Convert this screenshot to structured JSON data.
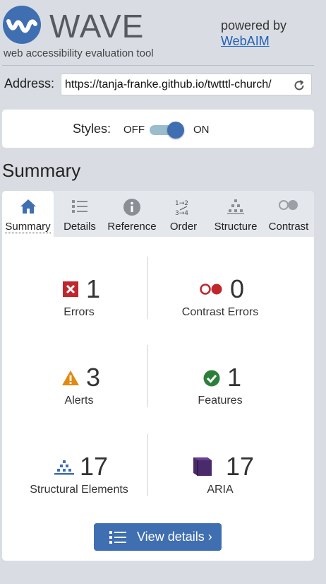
{
  "header": {
    "title": "WAVE",
    "tagline": "web accessibility evaluation tool",
    "powered_by": "powered by",
    "webaim_link": "WebAIM"
  },
  "address": {
    "label": "Address:",
    "value": "https://tanja-franke.github.io/twtttl-church/"
  },
  "styles": {
    "label": "Styles:",
    "off": "OFF",
    "on": "ON",
    "state": "on"
  },
  "summary_heading": "Summary",
  "tabs": [
    {
      "label": "Summary",
      "icon": "home-icon",
      "active": true
    },
    {
      "label": "Details",
      "icon": "list-icon",
      "active": false
    },
    {
      "label": "Reference",
      "icon": "info-icon",
      "active": false
    },
    {
      "label": "Order",
      "icon": "order-icon",
      "active": false
    },
    {
      "label": "Structure",
      "icon": "structure-icon",
      "active": false
    },
    {
      "label": "Contrast",
      "icon": "contrast-icon",
      "active": false
    }
  ],
  "stats": {
    "errors": {
      "count": "1",
      "label": "Errors",
      "icon": "error-icon"
    },
    "contrast_errors": {
      "count": "0",
      "label": "Contrast Errors",
      "icon": "contrast-error-icon"
    },
    "alerts": {
      "count": "3",
      "label": "Alerts",
      "icon": "alert-icon"
    },
    "features": {
      "count": "1",
      "label": "Features",
      "icon": "feature-icon"
    },
    "structural": {
      "count": "17",
      "label": "Structural Elements",
      "icon": "structure-icon"
    },
    "aria": {
      "count": "17",
      "label": "ARIA",
      "icon": "aria-icon"
    }
  },
  "view_details_label": "View details ›",
  "colors": {
    "brand_blue": "#3f6fb1",
    "error_red": "#c0272d",
    "alert_orange": "#e08a12",
    "feature_green": "#2c7f3b",
    "aria_purple": "#4b2a6b"
  }
}
